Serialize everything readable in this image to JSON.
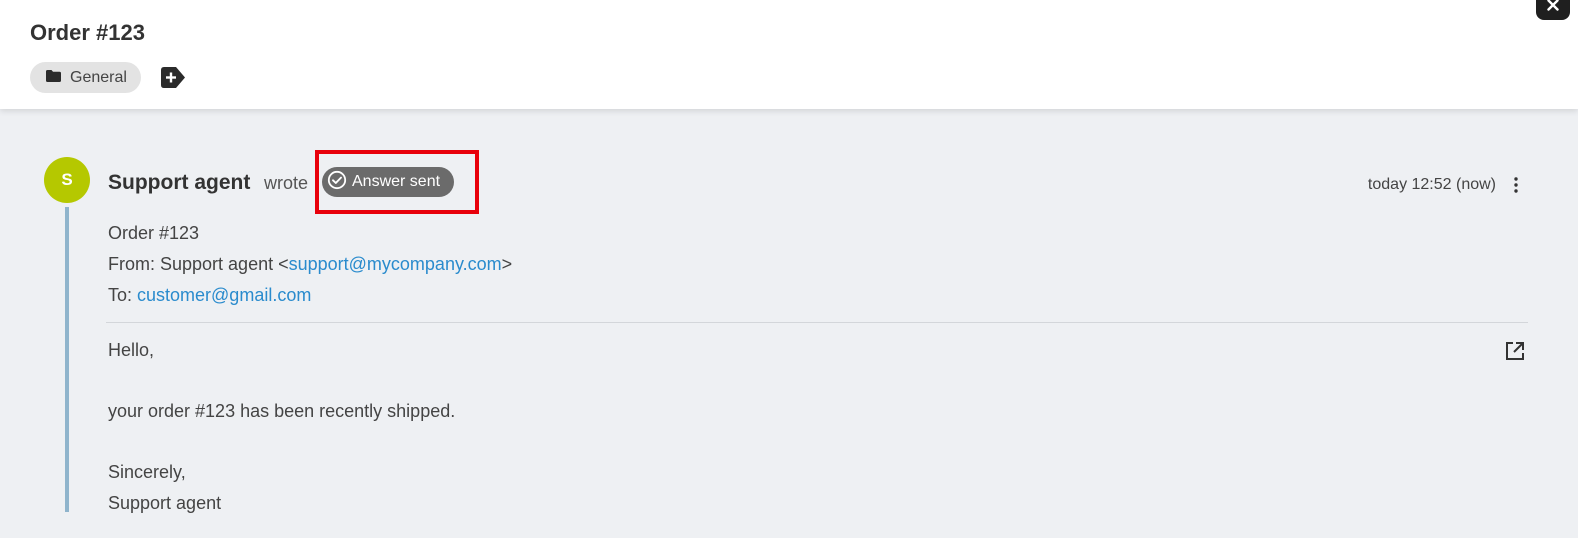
{
  "window": {
    "close_icon": "close-icon"
  },
  "ticket": {
    "title": "Order #123",
    "tag_label": "General",
    "tag_icon": "folder-icon",
    "add_tag_icon": "add-tag-icon"
  },
  "article": {
    "avatar_initial": "S",
    "avatar_color": "#b5c800",
    "sender": "Support agent",
    "wrote": "wrote",
    "status_label": "Answer sent",
    "status_icon": "check-circle-icon",
    "timestamp": "today 12:52 (now)",
    "subject": "Order #123",
    "from_prefix": "From: Support agent <",
    "from_email": "support@mycompany.com",
    "from_suffix": ">",
    "to_prefix": "To: ",
    "to_email": "customer@gmail.com",
    "body_lines": [
      "Hello,",
      "",
      "your order #123 has been recently shipped.",
      "",
      "Sincerely,",
      "Support agent"
    ],
    "link_color": "#2a8bcd",
    "highlight_color": "#e8000b"
  }
}
